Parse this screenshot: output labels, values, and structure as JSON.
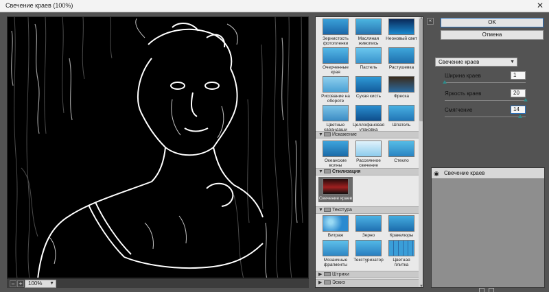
{
  "window": {
    "title": "Свечение краев (100%)",
    "close_glyph": "✕"
  },
  "zoom": {
    "minus": "−",
    "plus": "+",
    "value": "100%"
  },
  "gallery": {
    "row0": [
      {
        "label": "Зернистость фотопленки",
        "icon": "filter-thumb-icon"
      },
      {
        "label": "Масляная живопись",
        "icon": "filter-thumb-icon"
      },
      {
        "label": "Неоновый свет",
        "icon": "filter-thumb-icon"
      }
    ],
    "row1": [
      {
        "label": "Очерченные края",
        "icon": "filter-thumb-icon"
      },
      {
        "label": "Пастель",
        "icon": "filter-thumb-icon"
      },
      {
        "label": "Растушевка",
        "icon": "filter-thumb-icon"
      }
    ],
    "row2": [
      {
        "label": "Рисование на обороте",
        "icon": "filter-thumb-icon"
      },
      {
        "label": "Сухая кисть",
        "icon": "filter-thumb-icon"
      },
      {
        "label": "Фреска",
        "icon": "filter-thumb-icon"
      }
    ],
    "row3": [
      {
        "label": "Цветные карандаши",
        "icon": "filter-thumb-icon"
      },
      {
        "label": "Целлофановая упаковка",
        "icon": "filter-thumb-icon"
      },
      {
        "label": "Шпатель",
        "icon": "filter-thumb-icon"
      }
    ],
    "distort": {
      "label": "Искажение",
      "items": [
        "Океанские волны",
        "Рассеянное свечение",
        "Стекло"
      ]
    },
    "stylize": {
      "label": "Стилизация",
      "items": [
        "Свечение краев"
      ]
    },
    "texture": {
      "label": "Текстура",
      "items": [
        "Витраж",
        "Зерно",
        "Кракелюры",
        "Мозаичные фрагменты",
        "Текстуризатор",
        "Цветная плитка"
      ]
    },
    "strokes": {
      "label": "Штрихи"
    },
    "sketch": {
      "label": "Эскиз"
    }
  },
  "buttons": {
    "ok": "OK",
    "cancel": "Отмена",
    "collapse": "«"
  },
  "filter_select": {
    "value": "Свечение краев"
  },
  "params": [
    {
      "label": "Ширина краев",
      "value": "1",
      "min": 1,
      "max": 14
    },
    {
      "label": "Яркость краев",
      "value": "20",
      "min": 0,
      "max": 20
    },
    {
      "label": "Смягчение",
      "value": "14",
      "min": 1,
      "max": 15
    }
  ],
  "layers": {
    "name": "Свечение краев"
  },
  "colors": {
    "dialog_bg": "#535353",
    "accent": "#2a72c0",
    "slider_knob": "#2e8b8b"
  }
}
